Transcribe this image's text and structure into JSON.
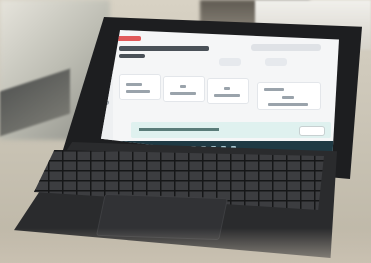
{
  "scene": {
    "description_tag": "photo-of-tablet-with-keyboard",
    "device": "tablet-with-detachable-keyboard",
    "screen_app": "dashboard"
  },
  "colors": {
    "screen_bg": "#f5f6f7",
    "accent_red": "#e15a5a",
    "banner_teal": "#dff1ef",
    "taskbar": "#1f3a44",
    "device_body": "#1d1e20"
  }
}
